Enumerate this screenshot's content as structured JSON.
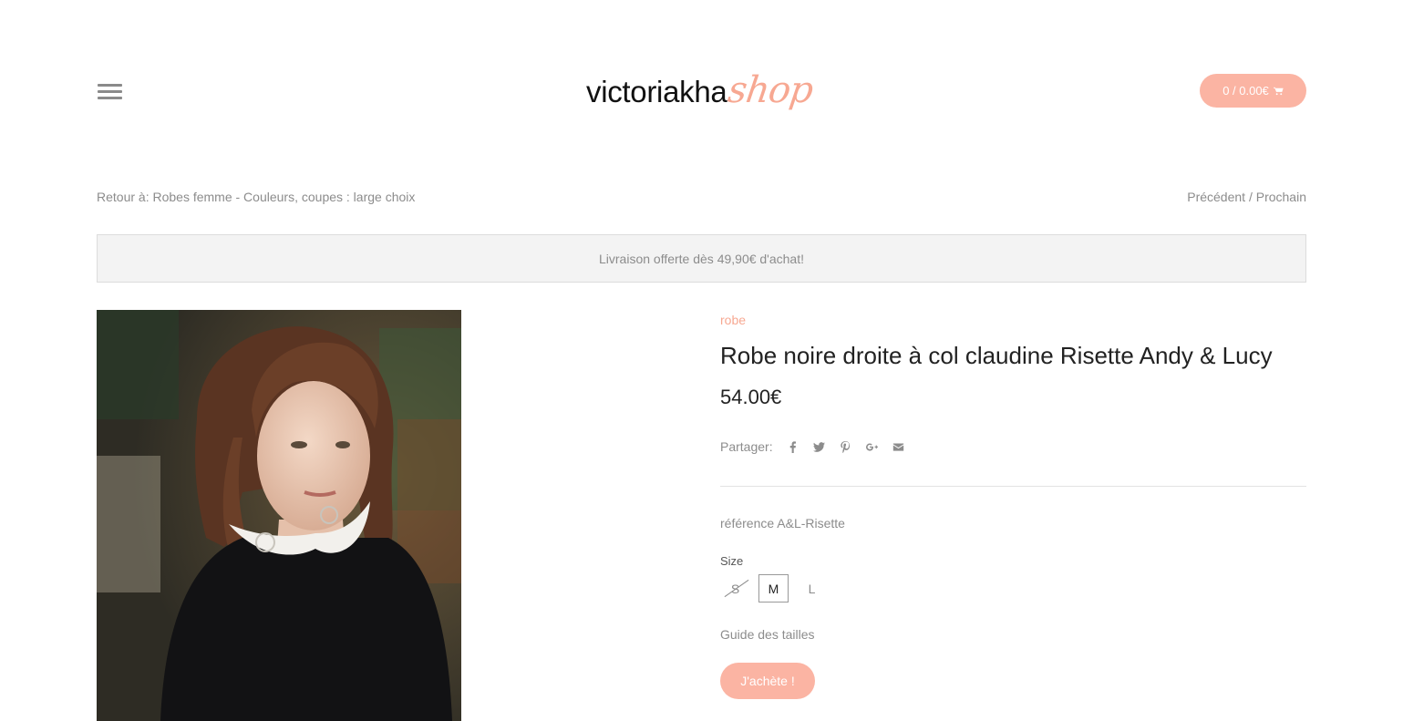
{
  "header": {
    "logo_main": "victoriakha",
    "logo_script": "shop",
    "cart_label": "0 / 0.00€"
  },
  "breadcrumb": {
    "text": "Retour à: Robes femme - Couleurs, coupes : large choix"
  },
  "pager": {
    "previous": "Précédent",
    "separator": " / ",
    "next": "Prochain"
  },
  "banner": {
    "text": "Livraison offerte dès 49,90€ d'achat!"
  },
  "product": {
    "category": "robe",
    "title": "Robe noire droite à col claudine Risette Andy & Lucy",
    "price": "54.00€",
    "share_label": "Partager:",
    "share_icons": [
      "facebook-icon",
      "twitter-icon",
      "pinterest-icon",
      "google-plus-icon",
      "email-icon"
    ],
    "reference": "référence A&L-Risette",
    "size_label": "Size",
    "sizes": [
      {
        "label": "S",
        "state": "unavailable"
      },
      {
        "label": "M",
        "state": "selected"
      },
      {
        "label": "L",
        "state": "available"
      }
    ],
    "size_guide": "Guide des tailles",
    "buy_label": "J'achète !"
  },
  "colors": {
    "accent": "#fbb4a3",
    "accent_text": "#f7a892",
    "muted_text": "#8c8c8c",
    "banner_bg": "#f3f3f3"
  }
}
